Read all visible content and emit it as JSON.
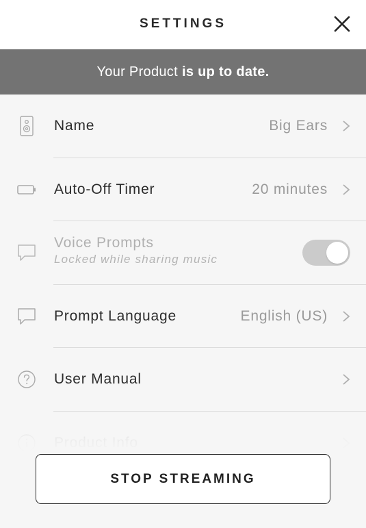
{
  "header": {
    "title": "SETTINGS",
    "close_icon": "close-icon"
  },
  "banner": {
    "text_normal": "Your Product",
    "text_bold": "is up to date."
  },
  "settings": [
    {
      "icon": "speaker-icon",
      "label": "Name",
      "value": "Big Ears",
      "has_chevron": true
    },
    {
      "icon": "battery-icon",
      "label": "Auto-Off Timer",
      "value": "20 minutes",
      "has_chevron": true
    },
    {
      "icon": "speech-bubble-icon",
      "label": "Voice Prompts",
      "sublabel": "Locked while sharing music",
      "toggle_on": true,
      "disabled": true
    },
    {
      "icon": "speech-bubble-icon",
      "label": "Prompt Language",
      "value": "English (US)",
      "has_chevron": true
    },
    {
      "icon": "help-circle-icon",
      "label": "User Manual",
      "has_chevron": true
    },
    {
      "icon": "info-circle-icon",
      "label": "Product Info",
      "has_chevron": true
    }
  ],
  "footer": {
    "stop_label": "STOP STREAMING"
  },
  "colors": {
    "banner_bg": "#737373",
    "page_bg": "#f6f6f6",
    "value_text": "#9a9a9a"
  }
}
